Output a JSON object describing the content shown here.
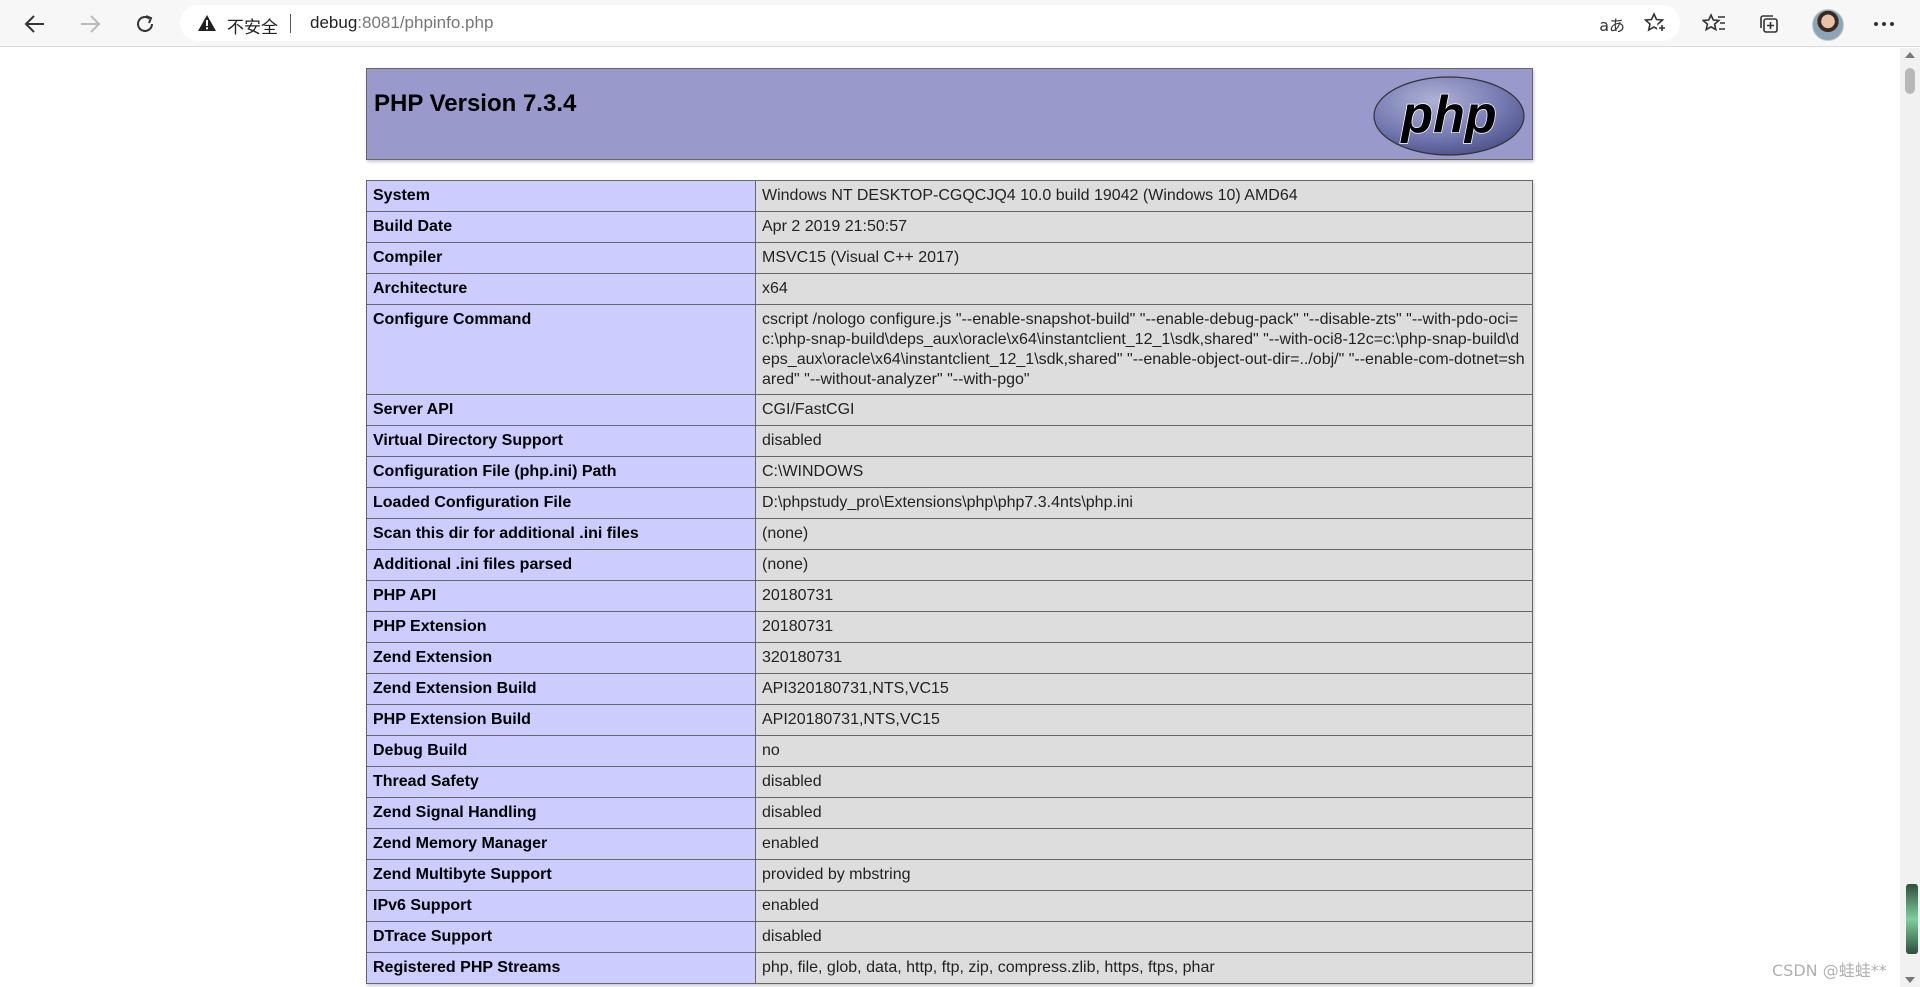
{
  "browser": {
    "security_text": "不安全",
    "url_host": "debug",
    "url_rest": ":8081/phpinfo.php",
    "read_aloud_label": "aあ"
  },
  "page": {
    "title": "PHP Version 7.3.4",
    "logo_text": "php",
    "rows": [
      {
        "k": "System",
        "v": "Windows NT DESKTOP-CGQCJQ4 10.0 build 19042 (Windows 10) AMD64"
      },
      {
        "k": "Build Date",
        "v": "Apr 2 2019 21:50:57"
      },
      {
        "k": "Compiler",
        "v": "MSVC15 (Visual C++ 2017)"
      },
      {
        "k": "Architecture",
        "v": "x64"
      },
      {
        "k": "Configure Command",
        "v": "cscript /nologo configure.js \"--enable-snapshot-build\" \"--enable-debug-pack\" \"--disable-zts\" \"--with-pdo-oci=c:\\php-snap-build\\deps_aux\\oracle\\x64\\instantclient_12_1\\sdk,shared\" \"--with-oci8-12c=c:\\php-snap-build\\deps_aux\\oracle\\x64\\instantclient_12_1\\sdk,shared\" \"--enable-object-out-dir=../obj/\" \"--enable-com-dotnet=shared\" \"--without-analyzer\" \"--with-pgo\""
      },
      {
        "k": "Server API",
        "v": "CGI/FastCGI"
      },
      {
        "k": "Virtual Directory Support",
        "v": "disabled"
      },
      {
        "k": "Configuration File (php.ini) Path",
        "v": "C:\\WINDOWS"
      },
      {
        "k": "Loaded Configuration File",
        "v": "D:\\phpstudy_pro\\Extensions\\php\\php7.3.4nts\\php.ini"
      },
      {
        "k": "Scan this dir for additional .ini files",
        "v": "(none)"
      },
      {
        "k": "Additional .ini files parsed",
        "v": "(none)"
      },
      {
        "k": "PHP API",
        "v": "20180731"
      },
      {
        "k": "PHP Extension",
        "v": "20180731"
      },
      {
        "k": "Zend Extension",
        "v": "320180731"
      },
      {
        "k": "Zend Extension Build",
        "v": "API320180731,NTS,VC15"
      },
      {
        "k": "PHP Extension Build",
        "v": "API20180731,NTS,VC15"
      },
      {
        "k": "Debug Build",
        "v": "no"
      },
      {
        "k": "Thread Safety",
        "v": "disabled"
      },
      {
        "k": "Zend Signal Handling",
        "v": "disabled"
      },
      {
        "k": "Zend Memory Manager",
        "v": "enabled"
      },
      {
        "k": "Zend Multibyte Support",
        "v": "provided by mbstring"
      },
      {
        "k": "IPv6 Support",
        "v": "enabled"
      },
      {
        "k": "DTrace Support",
        "v": "disabled"
      },
      {
        "k": "Registered PHP Streams",
        "v": "php, file, glob, data, http, ftp, zip, compress.zlib, https, ftps, phar"
      }
    ]
  },
  "watermark": "CSDN @蛙蛙**"
}
